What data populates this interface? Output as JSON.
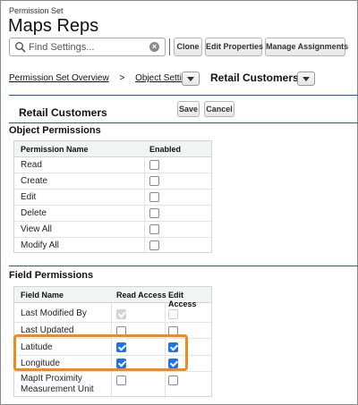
{
  "header": {
    "subtitle": "Permission Set",
    "title": "Maps Reps"
  },
  "toolbar": {
    "search_placeholder": "Find Settings...",
    "clone_label": "Clone",
    "edit_properties_label": "Edit Properties",
    "manage_assignments_label": "Manage Assignments"
  },
  "breadcrumb": {
    "overview": "Permission Set Overview",
    "arrow": ">",
    "object_settings": "Object Settings",
    "current": "Retail Customers"
  },
  "object_header": {
    "title": "Retail Customers",
    "save_label": "Save",
    "cancel_label": "Cancel"
  },
  "object_permissions": {
    "title": "Object Permissions",
    "columns": [
      "Permission Name",
      "Enabled"
    ],
    "rows": [
      {
        "name": "Read",
        "enabled": false
      },
      {
        "name": "Create",
        "enabled": false
      },
      {
        "name": "Edit",
        "enabled": false
      },
      {
        "name": "Delete",
        "enabled": false
      },
      {
        "name": "View All",
        "enabled": false
      },
      {
        "name": "Modify All",
        "enabled": false
      }
    ]
  },
  "field_permissions": {
    "title": "Field Permissions",
    "columns": [
      "Field Name",
      "Read Access",
      "Edit Access"
    ],
    "rows": [
      {
        "name": "Last Modified By",
        "read": true,
        "edit": false,
        "disabled": true
      },
      {
        "name": "Last Updated",
        "read": false,
        "edit": false,
        "disabled": false
      },
      {
        "name": "Latitude",
        "read": true,
        "edit": true,
        "disabled": false
      },
      {
        "name": "Longitude",
        "read": true,
        "edit": true,
        "disabled": false
      },
      {
        "name": "MapIt Proximity Measurement Unit",
        "read": false,
        "edit": false,
        "disabled": false
      }
    ]
  },
  "colors": {
    "accent": "#1a73e8",
    "highlight": "#ee8b1c",
    "section_line": "#1d5f9e"
  },
  "icons": {
    "search": "search-icon",
    "clear": "clear-icon",
    "dropdown": "chevron-down-icon"
  }
}
